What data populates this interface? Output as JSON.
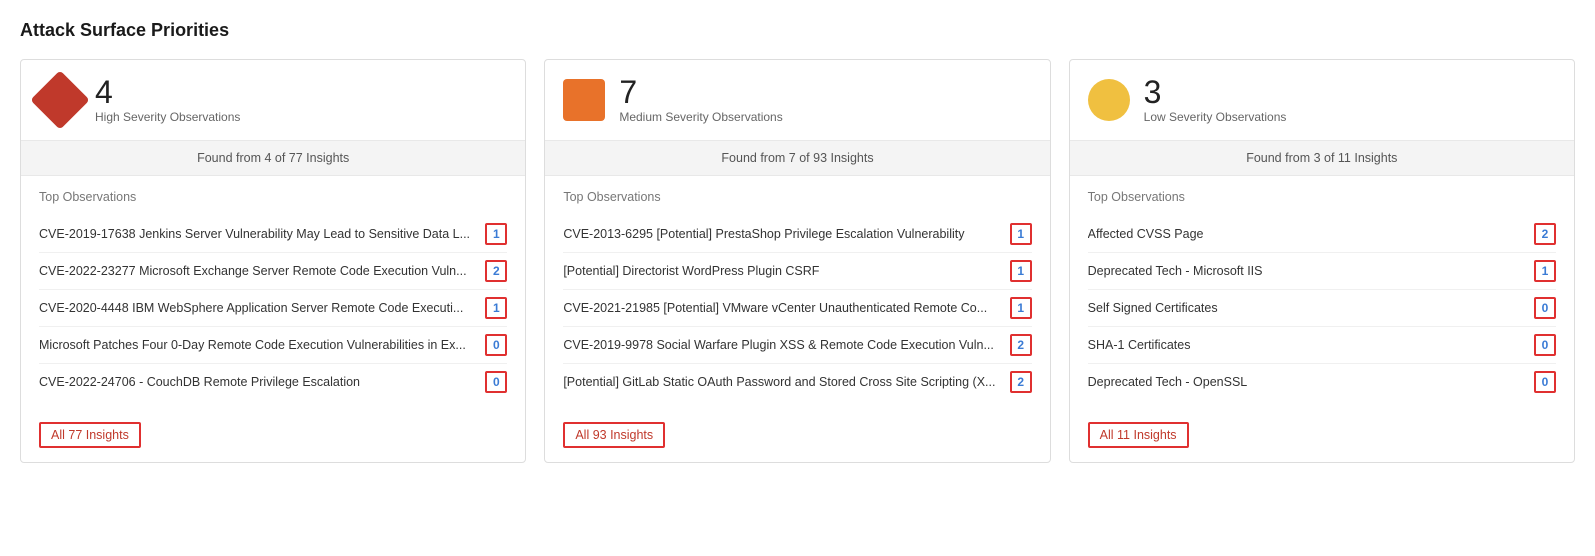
{
  "page": {
    "title": "Attack Surface Priorities"
  },
  "cards": [
    {
      "id": "high",
      "severity": "high",
      "count": "4",
      "label": "High Severity Observations",
      "found_text": "Found from 4 of 77 Insights",
      "section_title": "Top Observations",
      "observations": [
        {
          "label": "CVE-2019-17638 Jenkins Server Vulnerability May Lead to Sensitive Data L...",
          "badge": "1"
        },
        {
          "label": "CVE-2022-23277 Microsoft Exchange Server Remote Code Execution Vuln...",
          "badge": "2"
        },
        {
          "label": "CVE-2020-4448 IBM WebSphere Application Server Remote Code Executi...",
          "badge": "1"
        },
        {
          "label": "Microsoft Patches Four 0-Day Remote Code Execution Vulnerabilities in Ex...",
          "badge": "0"
        },
        {
          "label": "CVE-2022-24706 - CouchDB Remote Privilege Escalation",
          "badge": "0"
        }
      ],
      "insights_link": "All 77 Insights"
    },
    {
      "id": "medium",
      "severity": "medium",
      "count": "7",
      "label": "Medium Severity Observations",
      "found_text": "Found from 7 of 93 Insights",
      "section_title": "Top Observations",
      "observations": [
        {
          "label": "CVE-2013-6295 [Potential] PrestaShop Privilege Escalation Vulnerability",
          "badge": "1"
        },
        {
          "label": "[Potential] Directorist WordPress Plugin CSRF",
          "badge": "1"
        },
        {
          "label": "CVE-2021-21985 [Potential] VMware vCenter Unauthenticated Remote Co...",
          "badge": "1"
        },
        {
          "label": "CVE-2019-9978 Social Warfare Plugin XSS & Remote Code Execution Vuln...",
          "badge": "2"
        },
        {
          "label": "[Potential] GitLab Static OAuth Password and Stored Cross Site Scripting (X...",
          "badge": "2"
        }
      ],
      "insights_link": "All 93 Insights"
    },
    {
      "id": "low",
      "severity": "low",
      "count": "3",
      "label": "Low Severity Observations",
      "found_text": "Found from 3 of 11 Insights",
      "section_title": "Top Observations",
      "observations": [
        {
          "label": "Affected CVSS Page",
          "badge": "2"
        },
        {
          "label": "Deprecated Tech - Microsoft IIS",
          "badge": "1"
        },
        {
          "label": "Self Signed Certificates",
          "badge": "0"
        },
        {
          "label": "SHA-1 Certificates",
          "badge": "0"
        },
        {
          "label": "Deprecated Tech - OpenSSL",
          "badge": "0"
        }
      ],
      "insights_link": "All 11 Insights"
    }
  ]
}
